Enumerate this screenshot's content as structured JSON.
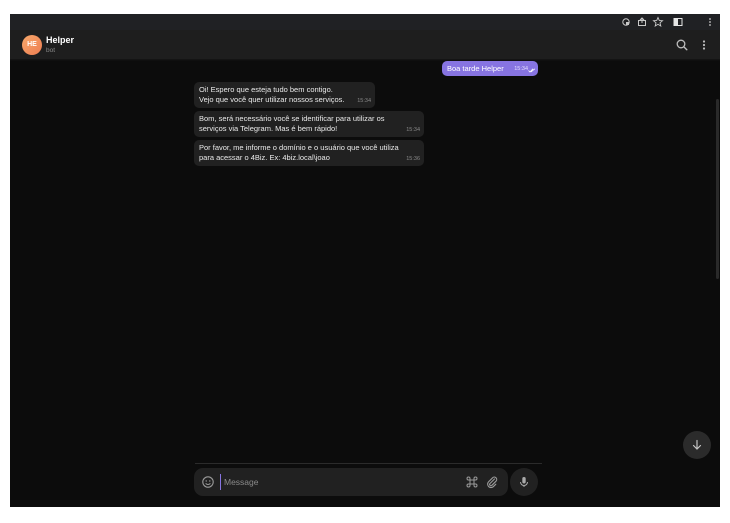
{
  "chat": {
    "title": "Helper",
    "subtitle": "bot",
    "avatar_initials": "HE"
  },
  "messages": [
    {
      "direction": "out",
      "lines": [
        "Boa tarde Helper"
      ],
      "time": "15:34"
    },
    {
      "direction": "in",
      "lines": [
        "Oi! Espero que esteja tudo bem contigo.",
        "Vejo que você quer utilizar nossos serviços."
      ],
      "time": "15:34"
    },
    {
      "direction": "in",
      "lines": [
        "Bom, será necessário você se identificar para utilizar os",
        "serviços via Telegram. Mas é bem rápido!"
      ],
      "time": "15:34"
    },
    {
      "direction": "in",
      "lines": [
        "Por favor, me informe o domínio e o usuário que você utiliza",
        "para acessar o 4Biz. Ex: 4biz.local\\joao"
      ],
      "time": "15:36"
    }
  ],
  "composer": {
    "placeholder": "Message"
  },
  "icons": {
    "search": "search-icon",
    "more": "more-vertical-icon",
    "emoji": "emoji-icon",
    "command": "command-icon",
    "attach": "paperclip-icon",
    "mic": "microphone-icon",
    "scroll_down": "arrow-down-icon"
  },
  "colors": {
    "accent": "#8774e1",
    "background": "#0f0f0f",
    "bubble_in": "#212121",
    "avatar": "#ee7d52"
  }
}
